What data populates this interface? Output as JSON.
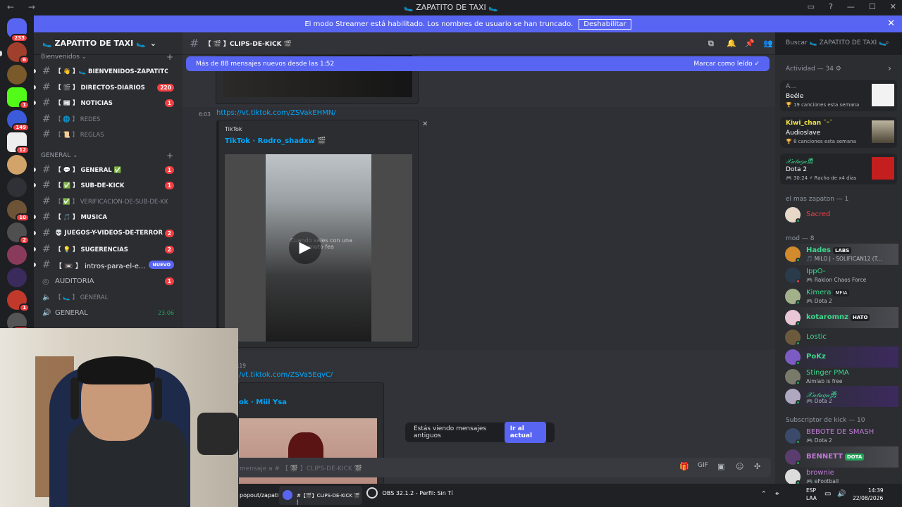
{
  "titlebar": {
    "title": "🥿 ZAPATITO DE TAXI 🥿",
    "nav": "← →",
    "window_controls": [
      "▭",
      "?",
      "—",
      "☐",
      "✕"
    ]
  },
  "banner": {
    "text": "El modo Streamer está habilitado. Los nombres de usuario se han truncado.",
    "button": "Deshabilitar"
  },
  "rail": {
    "badges": [
      "233",
      "6",
      "1",
      "149",
      "12",
      "10",
      "2",
      "1",
      "191"
    ]
  },
  "guild": {
    "name": "🥿 ZAPATITO DE TAXI 🥿"
  },
  "sidebar": {
    "cat1": "Bienvenidos",
    "cat2": "GENERAL",
    "channels": [
      {
        "name": "【 👋 】🥿 BIENVENIDOS-ZAPATITOS...",
        "badge": ""
      },
      {
        "name": "【 🎬 】 DIRECTOS-DIARIOS",
        "badge": "220"
      },
      {
        "name": "【 📰 】 NOTICIAS",
        "badge": "1"
      },
      {
        "name": "【 🌐 】 REDES",
        "badge": ""
      },
      {
        "name": "【 📜 】 REGLAS",
        "badge": ""
      },
      {
        "name": "【 💬 】 GENERAL ✅",
        "badge": "1"
      },
      {
        "name": "【 ✅ 】 SUB-DE-KICK",
        "badge": "1"
      },
      {
        "name": "【 ✅ 】 VERIFICACION-DE-SUB-DE-KICK",
        "badge": ""
      },
      {
        "name": "【 🎵 】 MUSICA",
        "badge": ""
      },
      {
        "name": "💀 JUEGOS-Y-VIDEOS-DE-TERROR",
        "badge": "2"
      },
      {
        "name": "【 💡 】 SUGERENCIAS",
        "badge": "2"
      },
      {
        "name": "【 📼 】 intros-para-el-e...",
        "badge": "NUEVO"
      },
      {
        "name": "AUDITORIA",
        "badge": "1"
      },
      {
        "name": "【 🥿 】 GENERAL",
        "badge": ""
      },
      {
        "name": "GENERAL",
        "badge": "23:06"
      }
    ]
  },
  "header": {
    "channel": "【 🎬 】CLIPS-DE-KICK 🎬",
    "search_placeholder": "Buscar 🥿 ZAPATITO DE TAXI 🥿"
  },
  "chat": {
    "new_messages": "Más de 88 mensajes nuevos desde las 1:52",
    "mark_read": "Marcar como leído",
    "msg1_time": "6:03",
    "msg1_link": "https://vt.tiktok.com/ZSVakEHMN/",
    "embed1_provider": "TikTok",
    "embed1_author": "TikTok · Rodro_shadxw 🎬",
    "video_overlay": "Cuando sales con una moto fea",
    "msg2_time": ":19",
    "msg2_link": "/vt.tiktok.com/ZSVa5EqvC/",
    "embed2_author": "ok · Miil Ysa",
    "old_msgs": "Estás viendo mensajes antiguos",
    "jump": "Ir al actual",
    "input_placeholder": "mensaje a # 【 🎬 】CLIPS-DE-KICK 🎬"
  },
  "members": {
    "activity_title": "Actividad — 34 ⚙",
    "activities": [
      {
        "name": "A...",
        "title": "Beéle",
        "sub": "🏆 19 canciones esta semana"
      },
      {
        "name": "Kiwi_chan ˘ᵕ˘",
        "title": "Audioslave",
        "sub": "🏆 8 canciones esta semana"
      },
      {
        "name": "𝒳𝒶𝓉𝒶𝑔𝒶勇",
        "title": "Dota 2",
        "sub": "🎮 30:24  ⚡ Racha de x4 días"
      }
    ],
    "group1": "el mas zapaton — 1",
    "group1_members": [
      {
        "name": "Sacred",
        "sub": ""
      }
    ],
    "group2": "mod — 8",
    "group2_members": [
      {
        "name": "Hades",
        "tag": "LABS",
        "sub": "🎵 MILO J - SOLIFICAN12 (T..."
      },
      {
        "name": "IppO-",
        "tag": "",
        "sub": "🎮 Rakion Chaos Force"
      },
      {
        "name": "Kimera",
        "tag": "MFIA",
        "sub": "🎮 Dota 2"
      },
      {
        "name": "kotaromnz",
        "tag": "HATO",
        "sub": ""
      },
      {
        "name": "Lostic",
        "tag": "",
        "sub": ""
      },
      {
        "name": "PoKz",
        "tag": "",
        "sub": ""
      },
      {
        "name": "Stinger PMA",
        "tag": "",
        "sub": "Aimlab is free"
      },
      {
        "name": "𝒳𝒶𝓉𝒶𝑔𝒶勇",
        "tag": "",
        "sub": "🎮 Dota 2"
      }
    ],
    "group3": "Subscriptor de kick — 10",
    "group3_members": [
      {
        "name": "BEBOTE DE SMASH",
        "tag": "",
        "sub": "🎮 Dota 2"
      },
      {
        "name": "BENNETT",
        "tag": "DOTA",
        "sub": ""
      },
      {
        "name": "brownie",
        "tag": "",
        "sub": "🎮 eFootball"
      }
    ]
  },
  "taskbar": {
    "item1": "popout/zapati",
    "item2": "#【🎬】CLIPS-DE-KICK 🎬 |",
    "item3": "OBS 32.1.2 - Perfil: Sin Tí",
    "lang": "ESP",
    "lang2": "LAA",
    "time": "14:39",
    "date": "22/08/2026"
  }
}
